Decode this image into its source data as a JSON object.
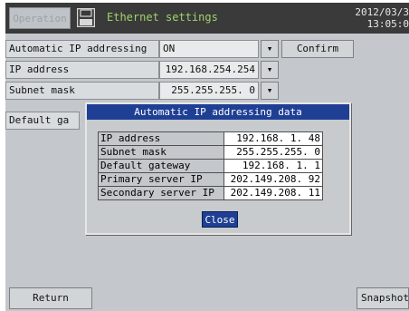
{
  "header": {
    "operation_label": "Operation",
    "title": "Ethernet settings",
    "date": "2012/03/3",
    "time": "13:05:0"
  },
  "form": {
    "rows": [
      {
        "label": "Automatic IP addressing",
        "value": "ON"
      },
      {
        "label": "IP address",
        "value": "192.168.254.254"
      },
      {
        "label": "Subnet mask",
        "value": "255.255.255.  0"
      },
      {
        "label": "Default ga",
        "value": ""
      }
    ],
    "confirm_label": "Confirm",
    "dropdown_arrow": "▾"
  },
  "modal": {
    "title": "Automatic IP addressing data",
    "rows": [
      {
        "label": "IP address",
        "value": "192.168.  1. 48"
      },
      {
        "label": "Subnet mask",
        "value": "255.255.255.  0"
      },
      {
        "label": "Default gateway",
        "value": "192.168.  1.  1"
      },
      {
        "label": "Primary server IP",
        "value": "202.149.208. 92"
      },
      {
        "label": "Secondary server IP",
        "value": "202.149.208. 11"
      }
    ],
    "close_label": "Close"
  },
  "footer": {
    "return_label": "Return",
    "snapshot_label": "Snapshot"
  }
}
